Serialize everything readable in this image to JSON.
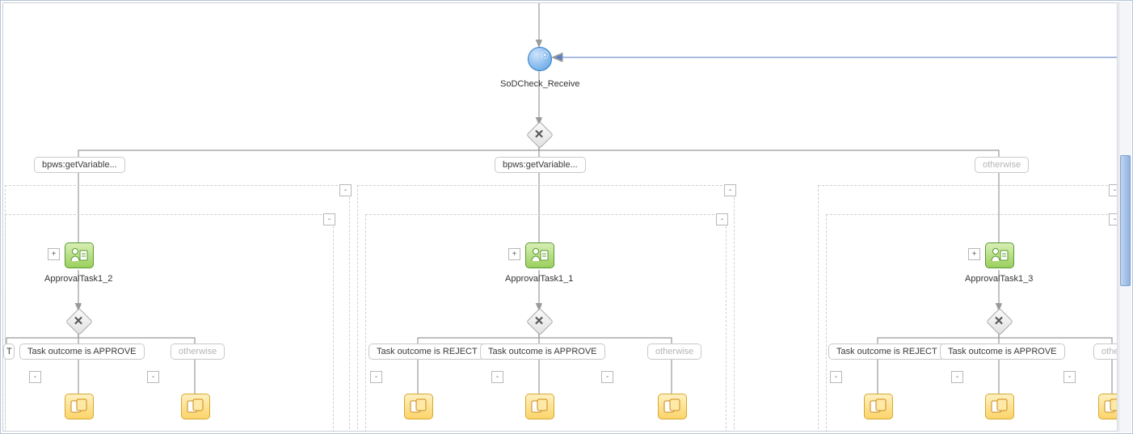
{
  "receive": {
    "label": "SoDCheck_Receive"
  },
  "branch_conditions": {
    "left": "bpws:getVariable...",
    "middle": "bpws:getVariable...",
    "right": "otherwise"
  },
  "tasks": {
    "left": "ApprovalTask1_2",
    "middle": "ApprovalTask1_1",
    "right": "ApprovalTask1_3"
  },
  "outcome_labels": {
    "approve": "Task outcome is APPROVE",
    "reject": "Task outcome is REJECT",
    "otherwise": "otherwise",
    "other_cut": "other"
  },
  "toggles": {
    "expand": "+",
    "collapse": "-"
  }
}
